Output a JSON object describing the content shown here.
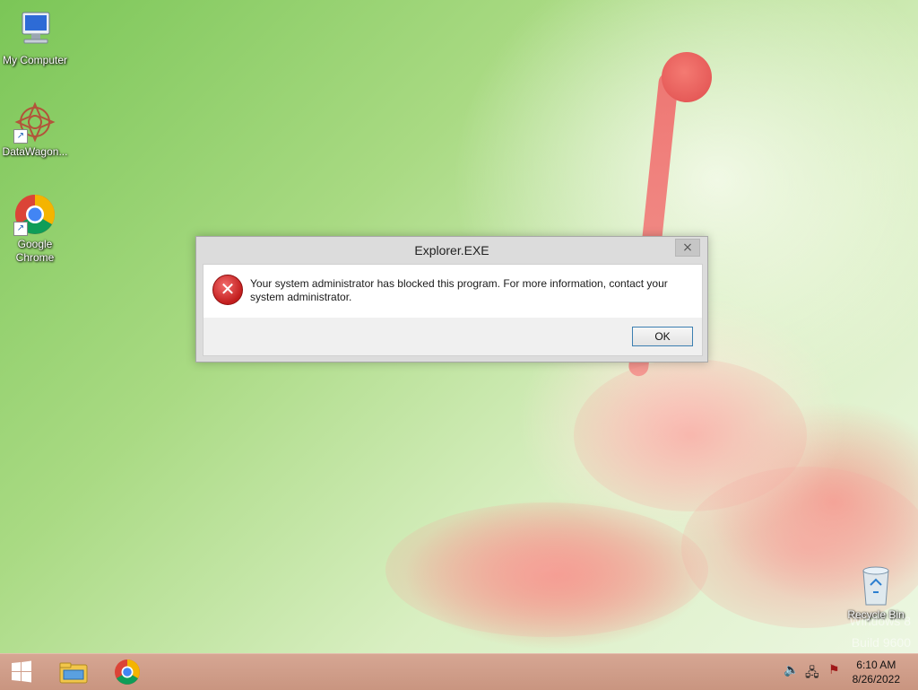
{
  "desktop": {
    "icons": [
      {
        "label": "My Computer"
      },
      {
        "label": "DataWagon..."
      },
      {
        "label": "Google Chrome"
      }
    ],
    "recycle_bin": {
      "label": "Recycle Bin"
    },
    "watermark": {
      "line1": "Windows 8",
      "line2": "Build 9600"
    }
  },
  "dialog": {
    "title": "Explorer.EXE",
    "close_glyph": "×",
    "message": "Your system administrator has blocked this program. For more information, contact your system administrator.",
    "ok_label": "OK",
    "icon": "error-icon",
    "icon_glyph": "✕"
  },
  "taskbar": {
    "buttons": [
      {
        "icon": "windows-start-icon"
      },
      {
        "icon": "file-explorer-icon"
      },
      {
        "icon": "chrome-icon"
      }
    ],
    "tray": {
      "volume_glyph": "🔈",
      "network_glyph": "🖧",
      "flag_glyph": "⚑"
    },
    "clock": {
      "time": "6:10 AM",
      "date": "8/26/2022"
    }
  },
  "colors": {
    "dialog_border": "#a8a8a8",
    "ok_focus_border": "#3c7fb1",
    "taskbar": "#c99580",
    "error_red": "#c21d1d"
  }
}
